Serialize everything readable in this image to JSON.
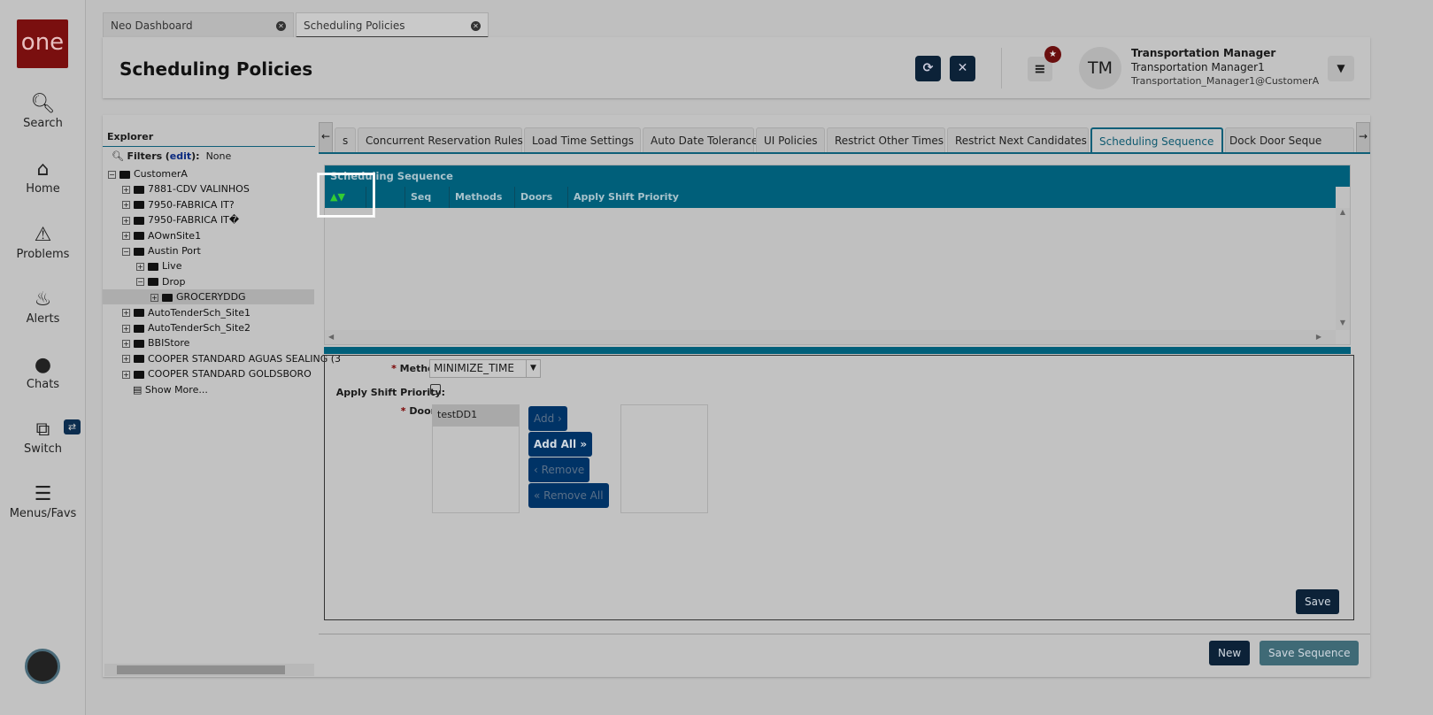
{
  "sidebar": {
    "logo": "one",
    "items": [
      {
        "label": "Search",
        "icon": "search-icon"
      },
      {
        "label": "Home",
        "icon": "home-icon"
      },
      {
        "label": "Problems",
        "icon": "warning-icon"
      },
      {
        "label": "Alerts",
        "icon": "bell-icon"
      },
      {
        "label": "Chats",
        "icon": "chat-icon"
      },
      {
        "label": "Switch",
        "icon": "switch-icon"
      },
      {
        "label": "Menus/Favs",
        "icon": "menu-icon"
      }
    ]
  },
  "tabs": [
    {
      "label": "Neo Dashboard"
    },
    {
      "label": "Scheduling Policies"
    }
  ],
  "header": {
    "title": "Scheduling Policies",
    "user": {
      "initials": "TM",
      "name": "Transportation Manager",
      "role": "Transportation Manager1",
      "email": "Transportation_Manager1@CustomerA"
    }
  },
  "explorer": {
    "title": "Explorer",
    "filters_label": "Filters",
    "edit": "edit",
    "filters_value": "None",
    "tree": [
      {
        "label": "CustomerA",
        "lvl": 0,
        "open": true
      },
      {
        "label": "7881-CDV VALINHOS",
        "lvl": 1
      },
      {
        "label": "7950-FABRICA IT?",
        "lvl": 1
      },
      {
        "label": "7950-FABRICA IT�",
        "lvl": 1
      },
      {
        "label": "AOwnSite1",
        "lvl": 1
      },
      {
        "label": "Austin Port",
        "lvl": 1,
        "open": true
      },
      {
        "label": "Live",
        "lvl": 2
      },
      {
        "label": "Drop",
        "lvl": 2,
        "open": true
      },
      {
        "label": "GROCERYDDG",
        "lvl": 3,
        "selected": true
      },
      {
        "label": "AutoTenderSch_Site1",
        "lvl": 1
      },
      {
        "label": "AutoTenderSch_Site2",
        "lvl": 1
      },
      {
        "label": "BBIStore",
        "lvl": 1
      },
      {
        "label": "COOPER STANDARD AGUAS SEALING (3",
        "lvl": 1
      },
      {
        "label": "COOPER STANDARD GOLDSBORO",
        "lvl": 1
      },
      {
        "label": "Show More...",
        "lvl": 1,
        "doc": true
      }
    ]
  },
  "policy_tabs": [
    "s",
    "Concurrent Reservation Rules",
    "Load Time Settings",
    "Auto Date Tolerance",
    "UI Policies",
    "Restrict Other Times",
    "Restrict Next Candidates",
    "Scheduling Sequence",
    "Dock Door Seque"
  ],
  "grid": {
    "title": "Scheduling Sequence",
    "columns": [
      "",
      "Seq",
      "Methods",
      "Doors",
      "Apply Shift Priority"
    ]
  },
  "form": {
    "method_label": "Method:",
    "method_value": "MINIMIZE_TIME",
    "shift_label": "Apply Shift Priority:",
    "doors_label": "Doors:",
    "available_doors": [
      "testDD1"
    ],
    "add": "Add ›",
    "add_all": "Add All »",
    "remove": "‹ Remove",
    "remove_all": "« Remove All",
    "save": "Save"
  },
  "footer": {
    "new": "New",
    "save_sequence": "Save Sequence"
  }
}
